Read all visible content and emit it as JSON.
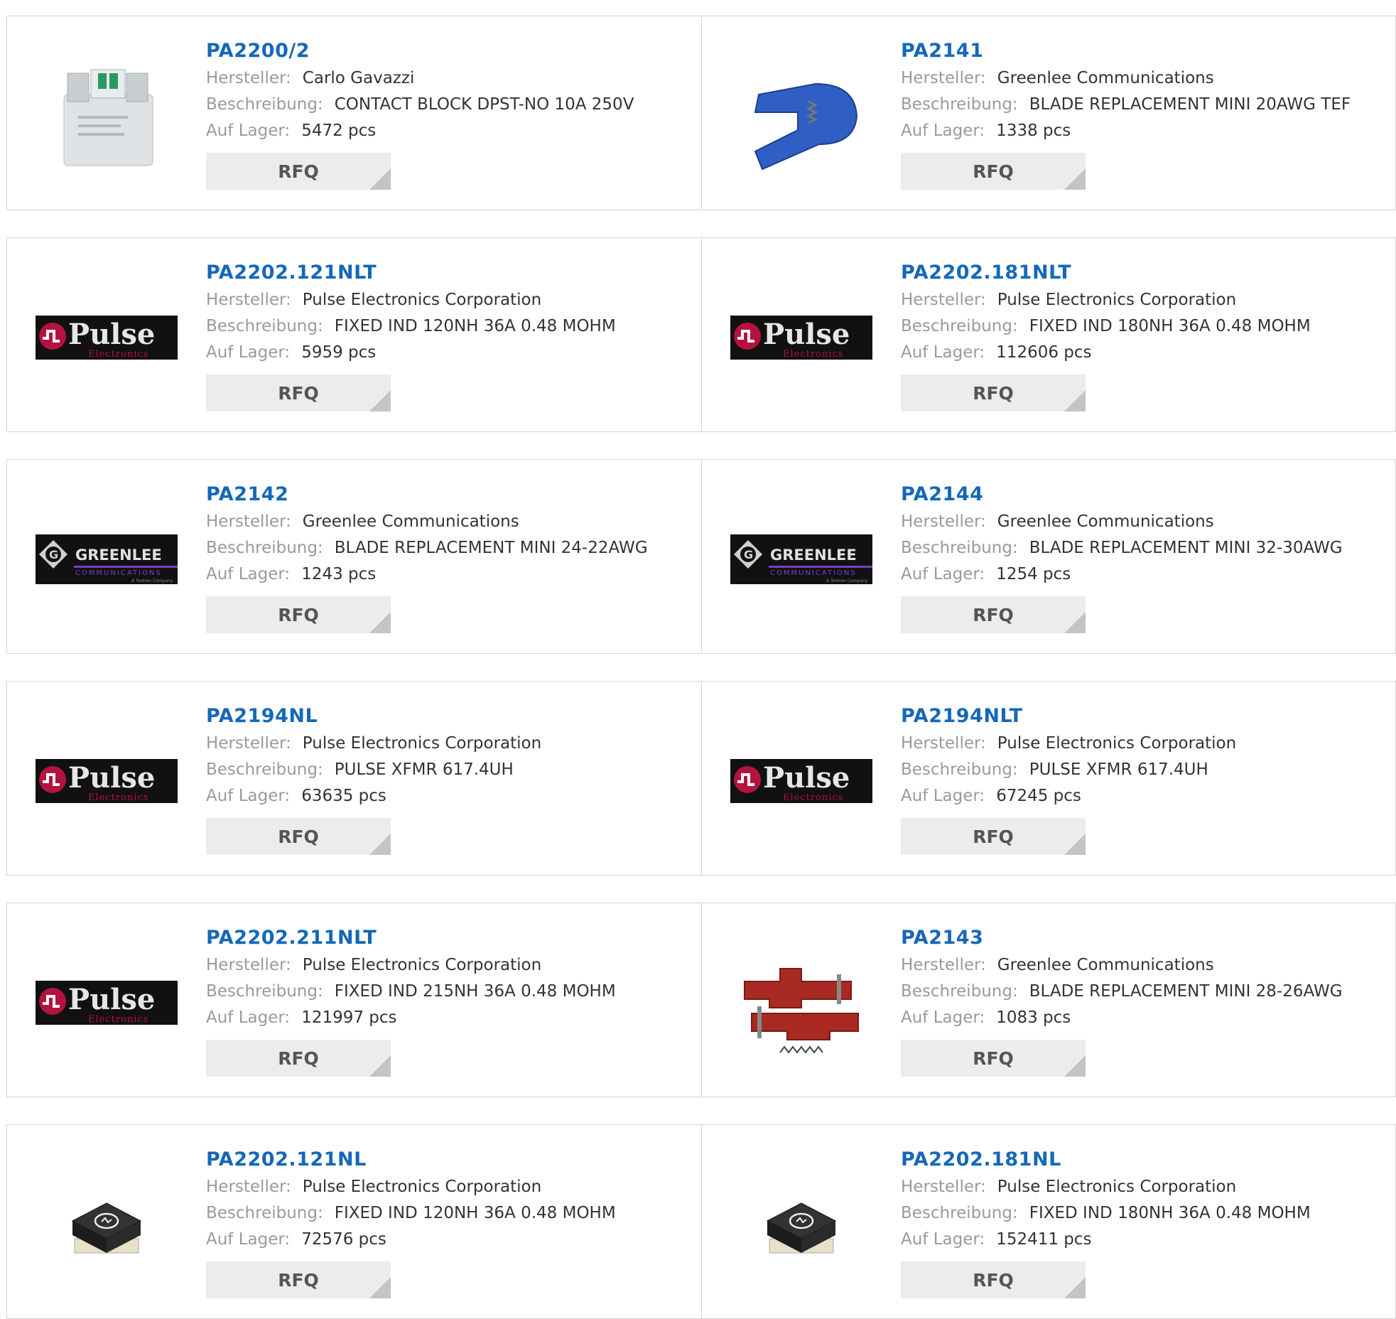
{
  "labels": {
    "manufacturer": "Hersteller:",
    "description": "Beschreibung:",
    "stock": "Auf Lager:",
    "rfq": "RFQ"
  },
  "products": [
    {
      "part": "PA2200/2",
      "manufacturer": "Carlo Gavazzi",
      "description": "CONTACT BLOCK DPST-NO 10A 250V",
      "stock": "5472 pcs",
      "image": "contact-block-photo"
    },
    {
      "part": "PA2141",
      "manufacturer": "Greenlee Communications",
      "description": "BLADE REPLACEMENT MINI 20AWG TEF",
      "stock": "1338 pcs",
      "image": "blue-stripper-photo"
    },
    {
      "part": "PA2202.121NLT",
      "manufacturer": "Pulse Electronics Corporation",
      "description": "FIXED IND 120NH 36A 0.48 MOHM",
      "stock": "5959 pcs",
      "image": "pulse-logo"
    },
    {
      "part": "PA2202.181NLT",
      "manufacturer": "Pulse Electronics Corporation",
      "description": "FIXED IND 180NH 36A 0.48 MOHM",
      "stock": "112606 pcs",
      "image": "pulse-logo"
    },
    {
      "part": "PA2142",
      "manufacturer": "Greenlee Communications",
      "description": "BLADE REPLACEMENT MINI 24-22AWG",
      "stock": "1243 pcs",
      "image": "greenlee-logo"
    },
    {
      "part": "PA2144",
      "manufacturer": "Greenlee Communications",
      "description": "BLADE REPLACEMENT MINI 32-30AWG",
      "stock": "1254 pcs",
      "image": "greenlee-logo"
    },
    {
      "part": "PA2194NL",
      "manufacturer": "Pulse Electronics Corporation",
      "description": "PULSE XFMR 617.4UH",
      "stock": "63635 pcs",
      "image": "pulse-logo"
    },
    {
      "part": "PA2194NLT",
      "manufacturer": "Pulse Electronics Corporation",
      "description": "PULSE XFMR 617.4UH",
      "stock": "67245 pcs",
      "image": "pulse-logo"
    },
    {
      "part": "PA2202.211NLT",
      "manufacturer": "Pulse Electronics Corporation",
      "description": "FIXED IND 215NH 36A 0.48 MOHM",
      "stock": "121997 pcs",
      "image": "pulse-logo"
    },
    {
      "part": "PA2143",
      "manufacturer": "Greenlee Communications",
      "description": "BLADE REPLACEMENT MINI 28-26AWG",
      "stock": "1083 pcs",
      "image": "red-blade-photo"
    },
    {
      "part": "PA2202.121NL",
      "manufacturer": "Pulse Electronics Corporation",
      "description": "FIXED IND 120NH 36A 0.48 MOHM",
      "stock": "72576 pcs",
      "image": "inductor-photo"
    },
    {
      "part": "PA2202.181NL",
      "manufacturer": "Pulse Electronics Corporation",
      "description": "FIXED IND 180NH 36A 0.48 MOHM",
      "stock": "152411 pcs",
      "image": "inductor-photo"
    }
  ],
  "logos": {
    "pulse": {
      "name": "Pulse",
      "sub": "Electronics"
    },
    "greenlee": {
      "name": "GREENLEE",
      "sub": "COMMUNICATIONS",
      "tag": "A Textron Company"
    }
  },
  "colors": {
    "link": "#1568b8",
    "label": "#9a9a9a",
    "value": "#333333",
    "rfq_bg": "#ececec",
    "pulse_red": "#b5123f",
    "greenlee_purple": "#7a3fc4"
  }
}
